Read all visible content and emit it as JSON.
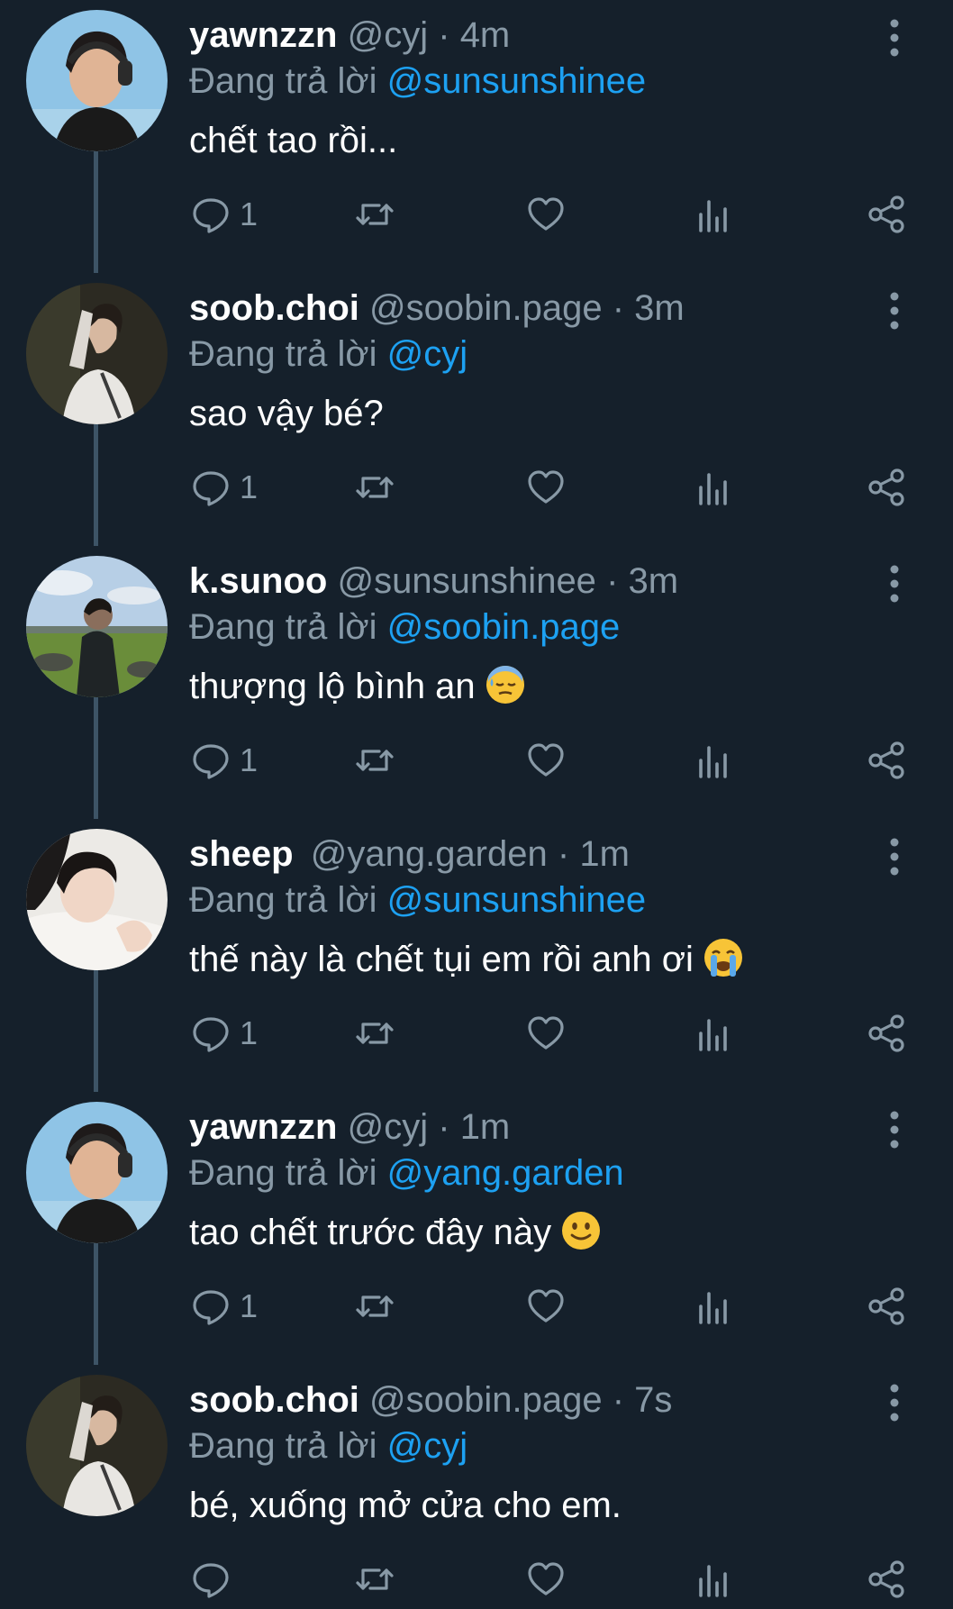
{
  "tweets": [
    {
      "name": "yawnzzn",
      "handle": "@cyj",
      "time": "4m",
      "reply_prefix": "Đang trả lời",
      "reply_to": "@sunsunshinee",
      "text": "chết tao rồi...",
      "emoji": "",
      "reply_count": "1",
      "avatar": "headphones-boy-avatar"
    },
    {
      "name": "soob.choi",
      "handle": "@soobin.page",
      "time": "3m",
      "reply_prefix": "Đang trả lời",
      "reply_to": "@cyj",
      "text": "sao vậy bé?",
      "emoji": "",
      "reply_count": "1",
      "avatar": "white-shirt-boy-avatar"
    },
    {
      "name": "k.sunoo",
      "handle": "@sunsunshinee",
      "time": "3m",
      "reply_prefix": "Đang trả lời",
      "reply_to": "@soobin.page",
      "text": "thượng lộ bình an",
      "emoji": "downcast-sweat-emoji",
      "reply_count": "1",
      "avatar": "outdoor-field-avatar"
    },
    {
      "name": "sheep",
      "handle": "@yang.garden",
      "time": "1m",
      "reply_prefix": "Đang trả lời",
      "reply_to": "@sunsunshinee",
      "text": "thế này là chết tụi em rồi anh ơi",
      "emoji": "crying-face-emoji",
      "reply_count": "1",
      "avatar": "pillow-boy-avatar"
    },
    {
      "name": "yawnzzn",
      "handle": "@cyj",
      "time": "1m",
      "reply_prefix": "Đang trả lời",
      "reply_to": "@yang.garden",
      "text": "tao chết trước đây này",
      "emoji": "slight-smile-emoji",
      "reply_count": "1",
      "avatar": "headphones-boy-avatar"
    },
    {
      "name": "soob.choi",
      "handle": "@soobin.page",
      "time": "7s",
      "reply_prefix": "Đang trả lời",
      "reply_to": "@cyj",
      "text": "bé, xuống mở cửa cho em.",
      "emoji": "",
      "reply_count": "",
      "avatar": "white-shirt-boy-avatar"
    }
  ],
  "colors": {
    "background": "#15202b",
    "muted": "#8899a6",
    "accent": "#1da1f2",
    "thread_line": "#3d5466"
  },
  "icons": [
    "reply-icon",
    "retweet-icon",
    "like-icon",
    "analytics-icon",
    "share-icon",
    "more-options-icon"
  ]
}
